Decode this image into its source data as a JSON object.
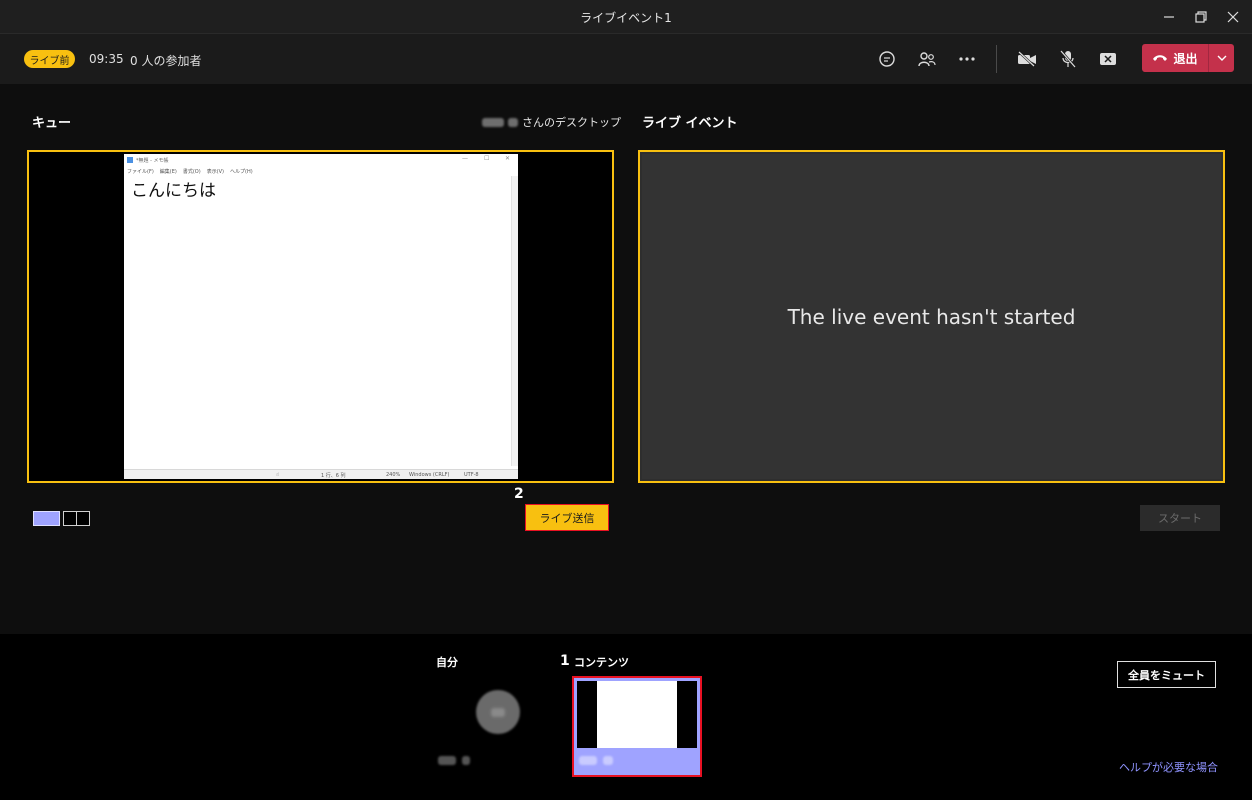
{
  "window": {
    "title": "ライブイベント1"
  },
  "toolbar": {
    "status_badge": "ライブ前",
    "time": "09:35",
    "participants": "0 人の参加者",
    "leave_label": "退出"
  },
  "queue": {
    "title": "キュー",
    "presenter_suffix": "さんのデスクトップ",
    "send_live_label": "ライブ送信",
    "marker": "2"
  },
  "notepad": {
    "title_text": "*無題 - メモ帳",
    "menu": [
      "ファイル(F)",
      "編集(E)",
      "書式(O)",
      "表示(V)",
      "ヘルプ(H)"
    ],
    "body_text": "こんにちは",
    "status": {
      "position": "1 行、6 列",
      "zoom": "240%",
      "line_ending": "Windows (CRLF)",
      "encoding": "UTF-8"
    }
  },
  "live": {
    "title": "ライブ イベント",
    "message": "The live event hasn't started",
    "start_label": "スタート"
  },
  "bottom": {
    "self_label": "自分",
    "content_label": "コンテンツ",
    "content_marker": "1",
    "mute_all_label": "全員をミュート",
    "help_link": "ヘルプが必要な場合"
  },
  "colors": {
    "accent_yellow": "#f8c010",
    "leave_red": "#c4314b",
    "highlight_red": "#e81123",
    "purple": "#9fa3ff"
  }
}
